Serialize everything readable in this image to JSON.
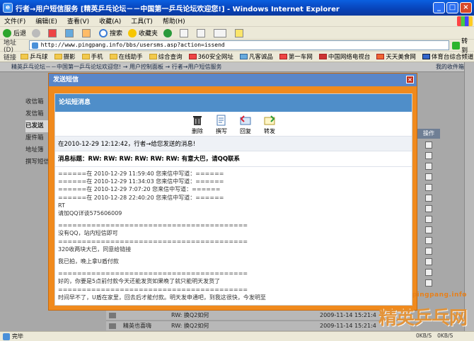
{
  "window": {
    "title": "行者→用户短信服务 [精英乒乓论坛－－中国第一乒乓论坛欢迎您!] - Windows Internet Explorer"
  },
  "menu": [
    "文件(F)",
    "编辑(E)",
    "查看(V)",
    "收藏(A)",
    "工具(T)",
    "帮助(H)"
  ],
  "toolbar": {
    "back": "后退",
    "search": "搜索",
    "favorites": "收藏夹"
  },
  "address": {
    "label": "地址(D)",
    "url": "http://www.pingpang.info/bbs/usersms.asp?action=issend",
    "go": "转到"
  },
  "links": {
    "label": "链接",
    "items": [
      "乒乓球",
      "摄影",
      "手机",
      "在线助手",
      "综合查询",
      "360安全网址",
      "凡客诚品",
      "第一车网",
      "中国网络电视台",
      "天天美食网",
      "体育台综合频道"
    ]
  },
  "page": {
    "breadcrumb": "精英乒乓论坛－－中国第一乒乓论坛欢迎您! → 用户控制面板 → 行者→用户短信服务",
    "mailbox": "我的收件箱",
    "nav": [
      "收信箱",
      "发信箱",
      "已发送",
      "废件箱",
      "地址簿",
      "撰写短信"
    ],
    "op_header": "操作",
    "bottom_rows": [
      {
        "sender": "",
        "subject": "RW: 换Q2如何",
        "date": "2009-11-14 15:21:4"
      },
      {
        "sender": "精英也喜嗨",
        "subject": "RW: 换Q2如何",
        "date": "2009-11-14 15:21:4"
      }
    ]
  },
  "modal": {
    "title": "发送短信",
    "panel_head": "论坛短消息",
    "actions": [
      "删除",
      "撰写",
      "回复",
      "转发"
    ],
    "from_line": "在2010-12-29 12:12:42，行者→给您发送的消息!",
    "subject": "消息标题：RW: RW: RW: RW: RW: RW: 有意大巴，请QQ联系",
    "body": [
      "======在 2010-12-29 11:59:40 您来信中写道：======",
      "======在 2010-12-29 11:34:03 您来信中写道：======",
      "======在 2010-12-29 7:07:20 您来信中写道：======",
      "======在 2010-12-28 22:40:20 您来信中写道：======",
      "RT",
      "请加QQ详谈575606009",
      "",
      "========================================",
      "没有QQ，站内短信即可",
      "========================================",
      "320收两块大巴，同意给链接",
      "",
      "我已拍，晚上拿U盾付款",
      "",
      "========================================",
      "好的，你要是5点前付款今天还能发货如果晚了就只能明天发货了",
      "========================================",
      "时间早不了，U盾在家里，回去后才能付款。明天发申通吧，到我这很快，今发明至"
    ]
  },
  "status": {
    "text": "完毕",
    "up": "0KB/S",
    "down": "0KB/S"
  },
  "watermark": {
    "url": "pingpang.info",
    "brand": "精英乒乓网"
  },
  "colors": {
    "modal_border": "#f08a1d",
    "panel_head": "#4f8ec9",
    "titlebar": "#0a5fe0"
  }
}
